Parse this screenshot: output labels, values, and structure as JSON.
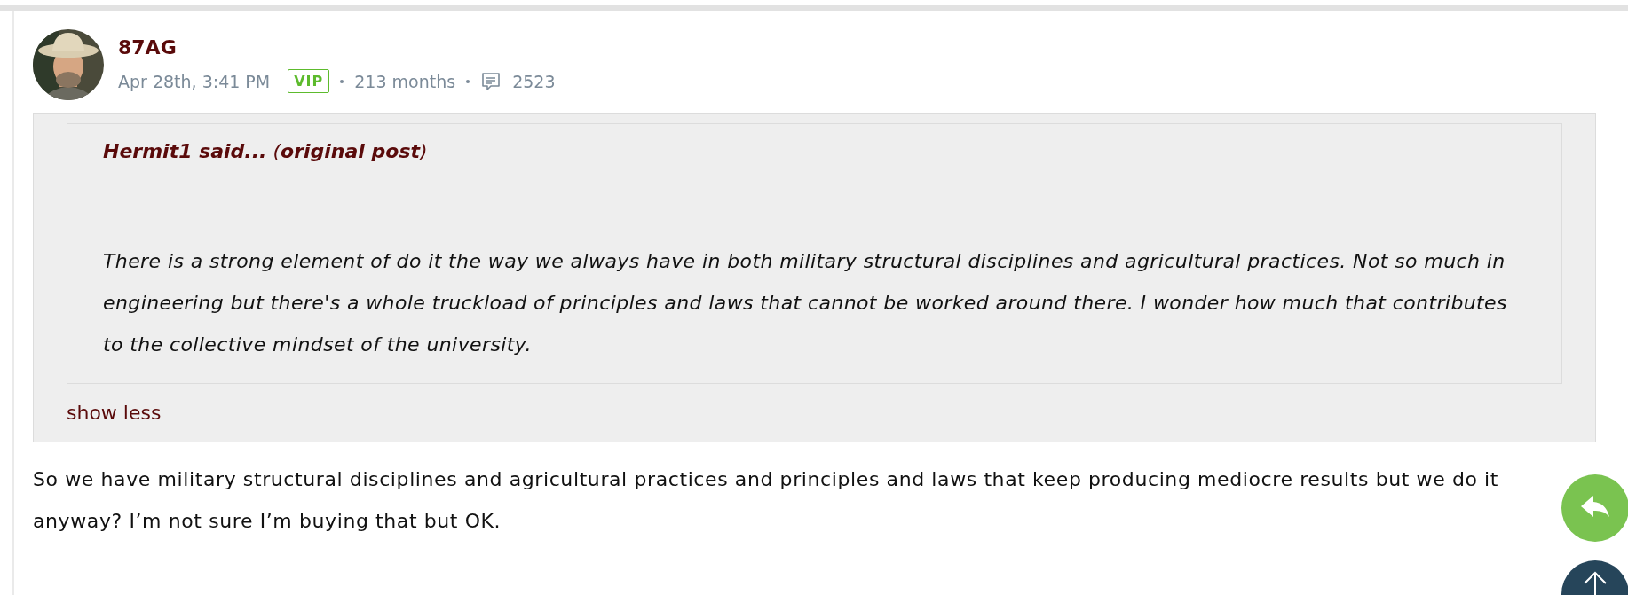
{
  "post": {
    "author": "87AG",
    "date": "Apr 28th, 3:41 PM",
    "badge": "VIP",
    "tenure": "213 months",
    "post_count": "2523",
    "quote": {
      "title": "**Hermit1 said...** (**original post**)",
      "text": "There is a strong element of do it the way we always have in both military structural disciplines and agricultural practices. Not so much in engineering but there's a whole truckload of principles and laws that cannot be worked around there. I wonder how much that contributes to the collective mindset of the university.",
      "toggle": "show less",
      "expanded": true
    },
    "body": "So we have military structural disciplines and agricultural practices and principles and laws that keep producing mediocre results but we do it anyway? I’m not sure I’m buying that but OK."
  }
}
